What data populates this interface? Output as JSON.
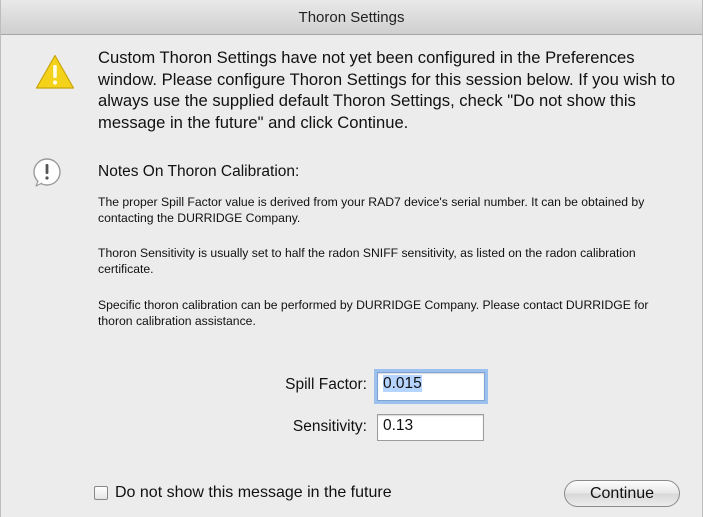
{
  "window": {
    "title": "Thoron Settings"
  },
  "message": {
    "icon": "warning-icon",
    "text": "Custom Thoron Settings have not yet been configured in the Preferences window. Please configure Thoron Settings for this session below. If you wish to always use the supplied default Thoron Settings, check \"Do not show this message in the future\" and click Continue."
  },
  "notes": {
    "icon": "info-icon",
    "title": "Notes On Thoron Calibration:",
    "items": [
      "The proper Spill Factor value is derived from your RAD7 device's serial number. It can be obtained by contacting the DURRIDGE Company.",
      "Thoron Sensitivity is usually set to half the radon SNIFF sensitivity, as listed on the radon calibration certificate.",
      "Specific thoron calibration can be performed by DURRIDGE Company. Please contact DURRIDGE for thoron calibration assistance."
    ]
  },
  "form": {
    "spill_factor": {
      "label": "Spill Factor:",
      "value": "0.015"
    },
    "sensitivity": {
      "label": "Sensitivity:",
      "value": "0.13"
    }
  },
  "footer": {
    "checkbox_label": "Do not show this message in the future",
    "checkbox_checked": false,
    "continue_label": "Continue"
  },
  "colors": {
    "warning_yellow": "#f5d21a",
    "focus_ring": "#9cc1ee",
    "selection": "#b5d5ff"
  }
}
